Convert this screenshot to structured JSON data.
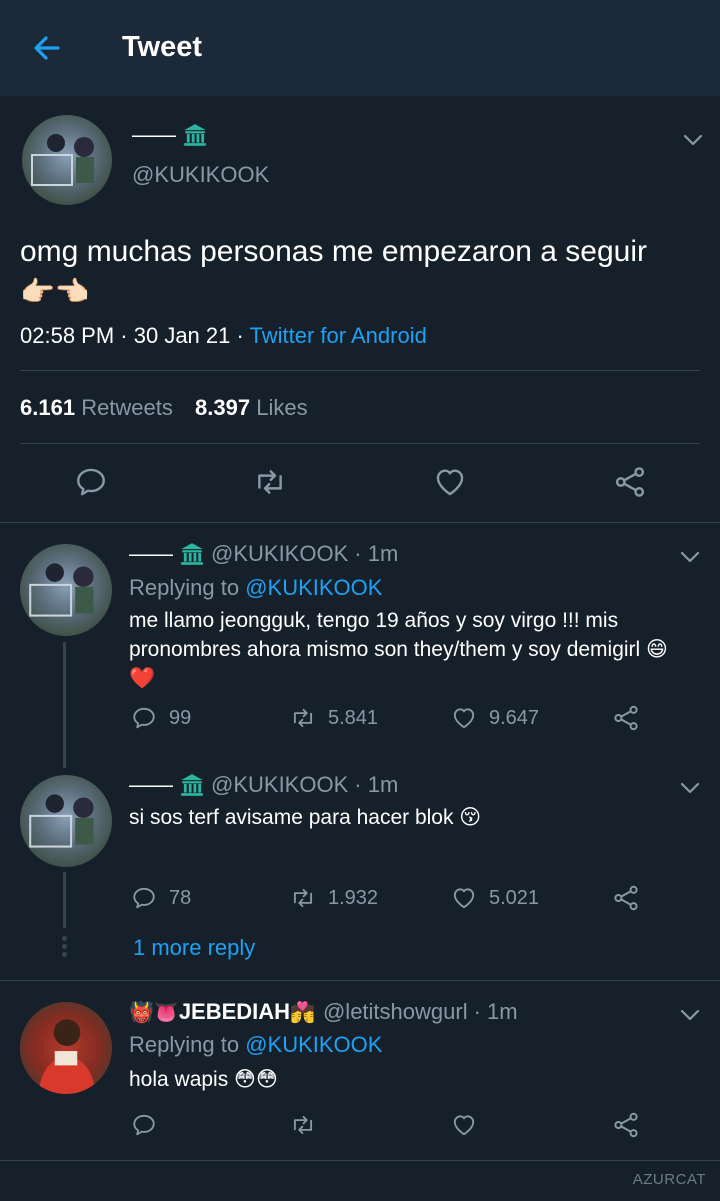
{
  "header": {
    "title": "Tweet"
  },
  "main_tweet": {
    "display_name": "——",
    "handle": "@KUKIKOOK",
    "text": "omg muchas personas me empezaron a seguir",
    "emoji": "👉🏻👈🏻",
    "time": "02:58 PM",
    "date": "30 Jan 21",
    "source": "Twitter for Android",
    "separator": " · ",
    "retweets_count": "6.161",
    "retweets_label": "Retweets",
    "likes_count": "8.397",
    "likes_label": "Likes"
  },
  "replies": [
    {
      "display_name": "——",
      "handle": "@KUKIKOOK",
      "time": "· 1m",
      "replying_prefix": "Replying to",
      "replying_to": "@KUKIKOOK",
      "text_line1": "me llamo jeongguk, tengo 19 años y soy virgo !!! mis",
      "text_line2": "pronombres ahora mismo son they/them y soy demigirl 😄",
      "text_line3": "❤️",
      "replies": "99",
      "retweets": "5.841",
      "likes": "9.647"
    },
    {
      "display_name": "——",
      "handle": "@KUKIKOOK",
      "time": "· 1m",
      "text_line1": "si sos terf avisame para hacer blok 😚",
      "replies": "78",
      "retweets": "1.932",
      "likes": "5.021"
    },
    {
      "display_name": "JEBEDIAH",
      "name_prefix_emoji": "👹👅",
      "name_suffix_emoji": "💏",
      "handle": "@letitshowgurl",
      "time": "· 1m",
      "replying_prefix": "Replying to",
      "replying_to": "@KUKIKOOK",
      "text_line1": "hola wapis 😳😳"
    }
  ],
  "more_replies": "1 more reply",
  "watermark": "AZURCAT",
  "colors": {
    "accent": "#1da1f2",
    "background": "#15202b",
    "header": "#1c2938",
    "muted": "#8899a6",
    "verified_badge": "#00a896"
  },
  "icons": [
    "back-arrow-icon",
    "bank-icon",
    "chevron-down-icon",
    "reply-icon",
    "retweet-icon",
    "heart-icon",
    "share-icon"
  ]
}
